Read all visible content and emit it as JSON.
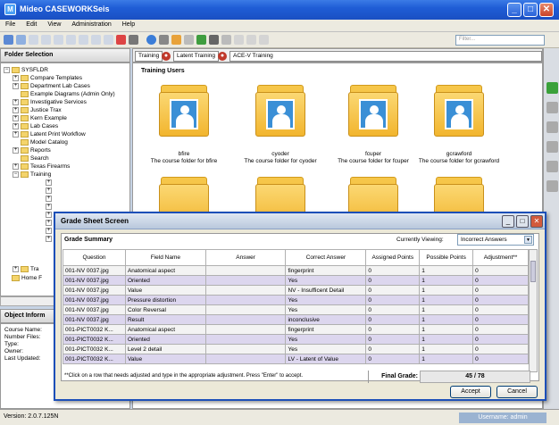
{
  "app": {
    "title": "Mideo CASEWORKSeis",
    "version": "Version: 2.0.7.125N",
    "user": "Username: admin"
  },
  "menu": [
    "File",
    "Edit",
    "View",
    "Administration",
    "Help"
  ],
  "toolbar": {
    "filter_placeholder": "Filter..."
  },
  "folder_selection": {
    "header": "Folder Selection",
    "items": [
      {
        "label": "SYSFLDR",
        "level": 0,
        "expander": "−"
      },
      {
        "label": "Compare Templates",
        "level": 1,
        "expander": "+"
      },
      {
        "label": "Department Lab Cases",
        "level": 1,
        "expander": "+"
      },
      {
        "label": "Example Diagrams (Admin Only)",
        "level": 1,
        "expander": ""
      },
      {
        "label": "Investigative Services",
        "level": 1,
        "expander": "+"
      },
      {
        "label": "Justice Trax",
        "level": 1,
        "expander": "+"
      },
      {
        "label": "Kern Example",
        "level": 1,
        "expander": "+"
      },
      {
        "label": "Lab Cases",
        "level": 1,
        "expander": "+"
      },
      {
        "label": "Latent Print Workflow",
        "level": 1,
        "expander": "+"
      },
      {
        "label": "Model Catalog",
        "level": 1,
        "expander": ""
      },
      {
        "label": "Reports",
        "level": 1,
        "expander": "+"
      },
      {
        "label": "Search",
        "level": 1,
        "expander": ""
      },
      {
        "label": "Texas Firearms",
        "level": 1,
        "expander": "+"
      },
      {
        "label": "Training",
        "level": 1,
        "expander": "−"
      }
    ],
    "lower_items": [
      {
        "label": "Tra",
        "level": 1,
        "expander": "+"
      },
      {
        "label": "Home F",
        "level": 0,
        "expander": ""
      }
    ]
  },
  "object_info": {
    "header": "Object Inform",
    "fields": [
      "Course Name:",
      "Number Files:",
      "Type:",
      "Owner:",
      "Last Updated:"
    ]
  },
  "tabs": [
    {
      "label": "Training"
    },
    {
      "label": "Latent Training"
    },
    {
      "label": "ACE-V Training"
    }
  ],
  "training_users": {
    "header": "Training Users",
    "folders": [
      {
        "name": "bfire",
        "desc": "The course folder for bfire"
      },
      {
        "name": "cyoder",
        "desc": "The course folder for cyoder"
      },
      {
        "name": "fcuper",
        "desc": "The course folder for fcuper"
      },
      {
        "name": "gcrawford",
        "desc": "The course folder for gcrawford"
      }
    ]
  },
  "grade_sheet": {
    "title": "Grade Sheet Screen",
    "summary_label": "Grade Summary",
    "viewing_label": "Currently Viewing:",
    "viewing_value": "Incorrect Answers",
    "columns": [
      "Question",
      "Field Name",
      "Answer",
      "Correct Answer",
      "Assigned Points",
      "Possible Points",
      "Adjustment**"
    ],
    "rows": [
      [
        "001-NV 0037.jpg",
        "Anatomical aspect",
        "",
        "fingerprint",
        "0",
        "1",
        "0"
      ],
      [
        "001-NV 0037.jpg",
        "Oriented",
        "",
        "Yes",
        "0",
        "1",
        "0"
      ],
      [
        "001-NV 0037.jpg",
        "Value",
        "",
        "NV - Insufficent Detail",
        "0",
        "1",
        "0"
      ],
      [
        "001-NV 0037.jpg",
        "Pressure distortion",
        "",
        "Yes",
        "0",
        "1",
        "0"
      ],
      [
        "001-NV 0037.jpg",
        "Color Reversal",
        "",
        "Yes",
        "0",
        "1",
        "0"
      ],
      [
        "001-NV 0037.jpg",
        "Result",
        "",
        "inconclusive",
        "0",
        "1",
        "0"
      ],
      [
        "001-PICT0032 K...",
        "Anatomical aspect",
        "",
        "fingerprint",
        "0",
        "1",
        "0"
      ],
      [
        "001-PICT0032 K...",
        "Oriented",
        "",
        "Yes",
        "0",
        "1",
        "0"
      ],
      [
        "001-PICT0032 K...",
        "Level 2 detail",
        "",
        "Yes",
        "0",
        "1",
        "0"
      ],
      [
        "001-PICT0032 K...",
        "Value",
        "",
        "LV - Latent of Value",
        "0",
        "1",
        "0"
      ]
    ],
    "note": "**Click on a row that needs adjusted and type in the appropriate adjustment. Press \"Enter\" to accept.",
    "final_grade_label": "Final Grade:",
    "final_grade_value": "45 / 78",
    "accept_label": "Accept",
    "cancel_label": "Cancel"
  },
  "colors": {
    "titlebar": "#1f5dd6",
    "row_alt": "#dcd6ee",
    "folder": "#f6c649"
  }
}
